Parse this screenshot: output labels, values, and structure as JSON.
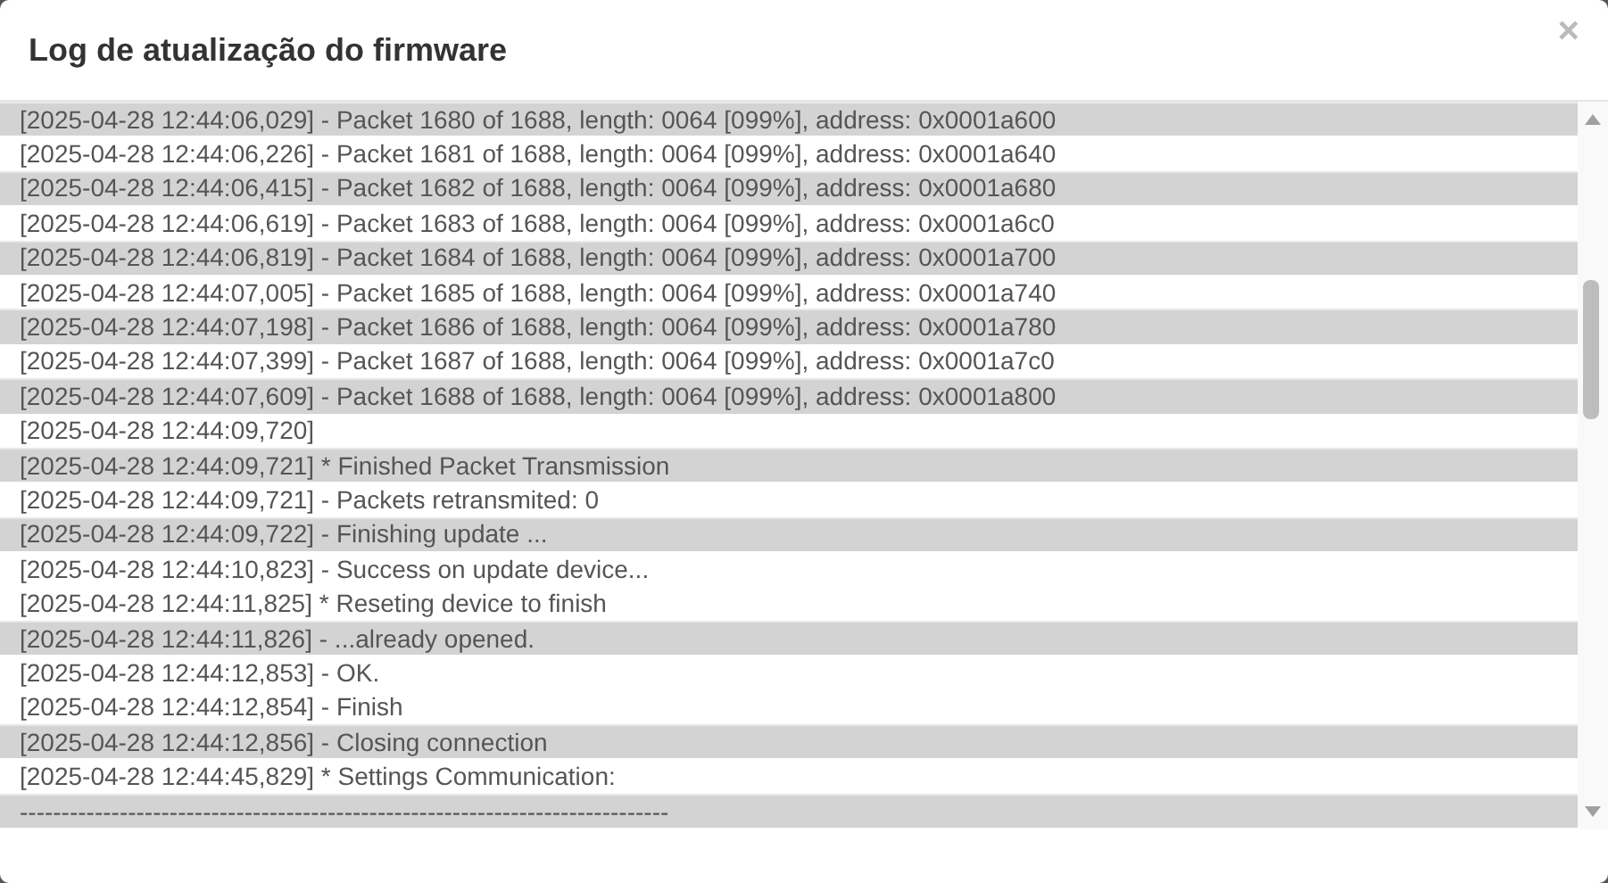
{
  "dialog": {
    "title": "Log de atualização do firmware",
    "close": "×"
  },
  "log": [
    {
      "text": "[2025-04-28 12:44:06,029] - Packet 1680 of 1688, length: 0064 [099%], address: 0x0001a600",
      "shaded": true
    },
    {
      "text": "[2025-04-28 12:44:06,226] - Packet 1681 of 1688, length: 0064 [099%], address: 0x0001a640",
      "shaded": false
    },
    {
      "text": "[2025-04-28 12:44:06,415] - Packet 1682 of 1688, length: 0064 [099%], address: 0x0001a680",
      "shaded": true
    },
    {
      "text": "[2025-04-28 12:44:06,619] - Packet 1683 of 1688, length: 0064 [099%], address: 0x0001a6c0",
      "shaded": false
    },
    {
      "text": "[2025-04-28 12:44:06,819] - Packet 1684 of 1688, length: 0064 [099%], address: 0x0001a700",
      "shaded": true
    },
    {
      "text": "[2025-04-28 12:44:07,005] - Packet 1685 of 1688, length: 0064 [099%], address: 0x0001a740",
      "shaded": false
    },
    {
      "text": "[2025-04-28 12:44:07,198] - Packet 1686 of 1688, length: 0064 [099%], address: 0x0001a780",
      "shaded": true
    },
    {
      "text": "[2025-04-28 12:44:07,399] - Packet 1687 of 1688, length: 0064 [099%], address: 0x0001a7c0",
      "shaded": false
    },
    {
      "text": "[2025-04-28 12:44:07,609] - Packet 1688 of 1688, length: 0064 [099%], address: 0x0001a800",
      "shaded": true
    },
    {
      "text": "[2025-04-28 12:44:09,720]",
      "shaded": false
    },
    {
      "text": "[2025-04-28 12:44:09,721] * Finished Packet Transmission",
      "shaded": true
    },
    {
      "text": "[2025-04-28 12:44:09,721] - Packets retransmited: 0",
      "shaded": false
    },
    {
      "text": "[2025-04-28 12:44:09,722] - Finishing update ...",
      "shaded": true
    },
    {
      "text": "[2025-04-28 12:44:10,823] - Success on update device...",
      "shaded": false
    },
    {
      "text": "[2025-04-28 12:44:11,825] * Reseting device to finish",
      "shaded": false
    },
    {
      "text": "[2025-04-28 12:44:11,826] - ...already opened.",
      "shaded": true
    },
    {
      "text": "[2025-04-28 12:44:12,853] - OK.",
      "shaded": false
    },
    {
      "text": "[2025-04-28 12:44:12,854] - Finish",
      "shaded": false
    },
    {
      "text": "[2025-04-28 12:44:12,856] - Closing connection",
      "shaded": true
    },
    {
      "text": "[2025-04-28 12:44:45,829] * Settings Communication:",
      "shaded": false
    },
    {
      "text": "------------------------------------------------------------------------------",
      "shaded": true
    }
  ]
}
